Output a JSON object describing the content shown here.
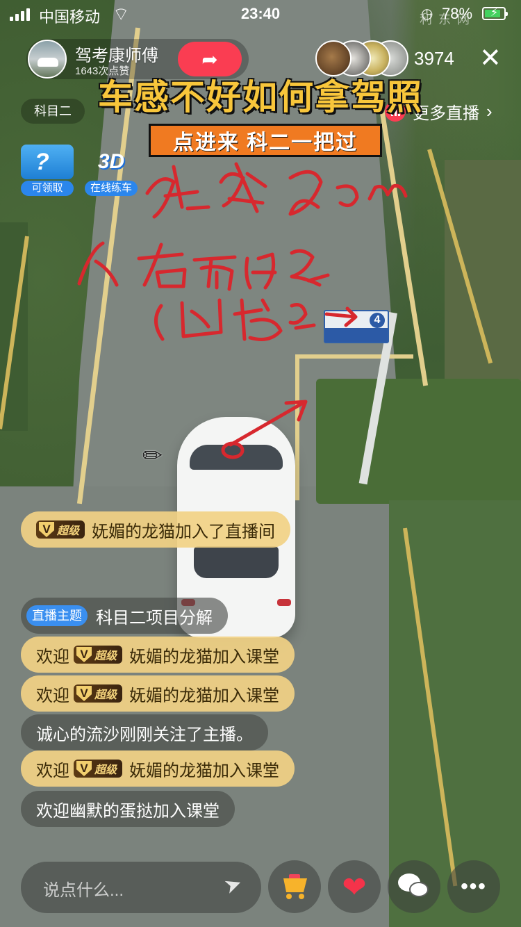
{
  "status_bar": {
    "carrier": "中国移动",
    "time": "23:40",
    "battery": "78%"
  },
  "watermark": "利 东 网",
  "anchor": {
    "name": "驾考康师傅",
    "likes": "1643次点赞"
  },
  "viewer_count": "3974",
  "subject_tag": "科目二",
  "more_live_label": "更多直播",
  "video_overlay": {
    "title": "车感不好如何拿驾照",
    "banner": "点进来 科二一把过"
  },
  "promos": [
    {
      "label": "可领取",
      "icon": "gift-box-icon"
    },
    {
      "label": "在线练车",
      "icon": "3d-icon",
      "art_text": "3D"
    }
  ],
  "sign_number": "4",
  "messages": [
    {
      "type": "vip-join",
      "badge": "超级",
      "text": "妩媚的龙猫加入了直播间"
    },
    {
      "type": "topic",
      "tag": "直播主题",
      "text": "科目二项目分解"
    },
    {
      "type": "vip-welcome",
      "prefix": "欢迎",
      "badge": "超级",
      "text": "妩媚的龙猫加入课堂"
    },
    {
      "type": "vip-welcome",
      "prefix": "欢迎",
      "badge": "超级",
      "text": "妩媚的龙猫加入课堂"
    },
    {
      "type": "plain",
      "text": "诚心的流沙刚刚关注了主播。"
    },
    {
      "type": "vip-welcome",
      "prefix": "欢迎",
      "badge": "超级",
      "text": "妩媚的龙猫加入课堂"
    },
    {
      "type": "plain",
      "text": "欢迎幽默的蛋挞加入课堂"
    }
  ],
  "input": {
    "placeholder": "说点什么..."
  },
  "icons": {
    "share": "share-arrow-icon",
    "close": "close-icon",
    "send": "send-icon",
    "cart": "shopping-cart-icon",
    "heart": "heart-icon",
    "wechat": "wechat-icon",
    "more": "more-dots-icon"
  },
  "colors": {
    "accent_red": "#fa3d52",
    "title_yellow": "#f8c63b",
    "banner_orange": "#f07a21",
    "vip_gold": "#f1d184",
    "topic_blue": "#3a8ff0"
  }
}
